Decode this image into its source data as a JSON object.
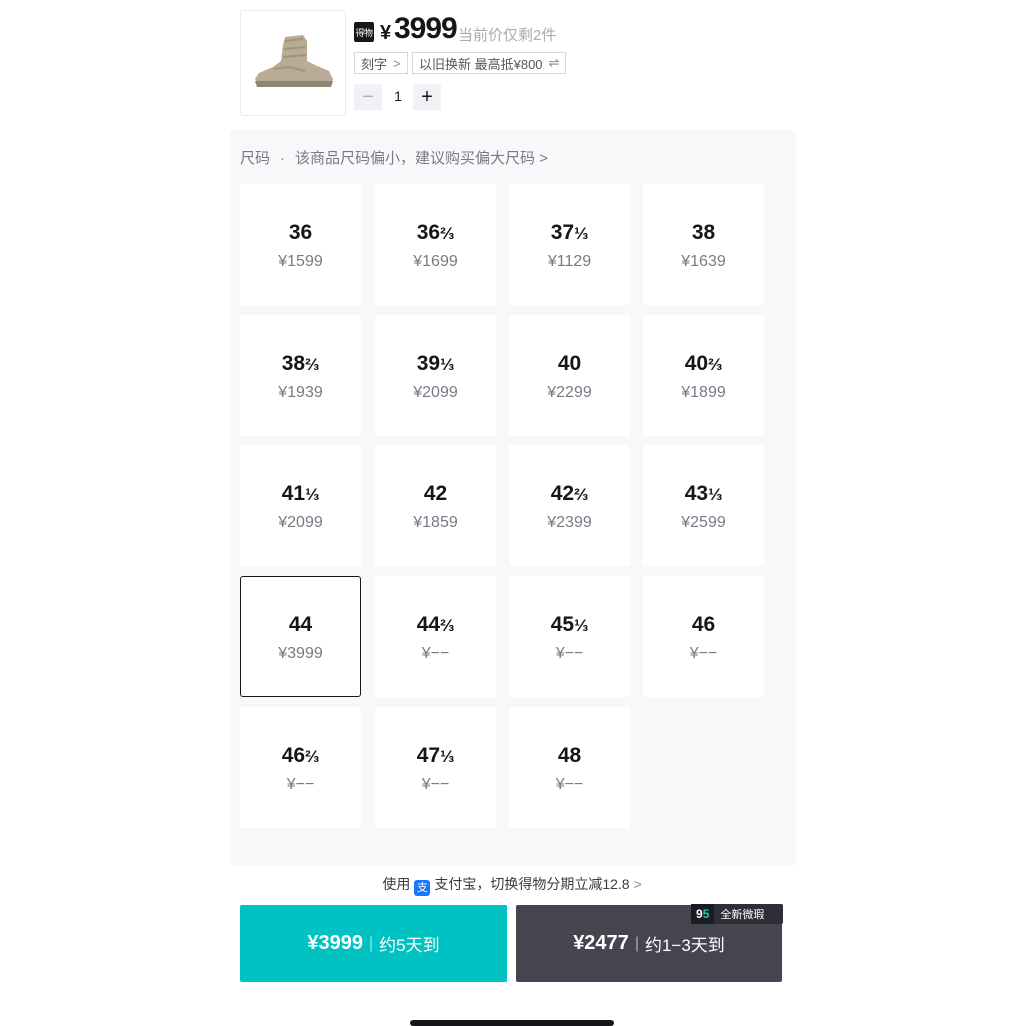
{
  "product": {
    "brand_badge": "得物",
    "currency": "¥",
    "price": "3999",
    "stock_note": "当前价仅剩2件",
    "engrave_chip": "刻字",
    "engrave_chip_symbol": ">",
    "trade_in_chip": "以旧换新 最高抵¥800",
    "trade_in_chip_symbol": "⇌",
    "quantity": "1",
    "minus_symbol": "−",
    "plus_symbol": "+"
  },
  "size_section": {
    "label": "尺码",
    "dot": "·",
    "hint": "该商品尺码偏小，建议购买偏大尺码",
    "chevron": ">",
    "selected": "44",
    "sizes": [
      {
        "whole": "36",
        "frac": "",
        "price": "¥1599"
      },
      {
        "whole": "36",
        "frac": "⅔",
        "price": "¥1699"
      },
      {
        "whole": "37",
        "frac": "⅓",
        "price": "¥1129"
      },
      {
        "whole": "38",
        "frac": "",
        "price": "¥1639"
      },
      {
        "whole": "38",
        "frac": "⅔",
        "price": "¥1939"
      },
      {
        "whole": "39",
        "frac": "⅓",
        "price": "¥2099"
      },
      {
        "whole": "40",
        "frac": "",
        "price": "¥2299"
      },
      {
        "whole": "40",
        "frac": "⅔",
        "price": "¥1899"
      },
      {
        "whole": "41",
        "frac": "⅓",
        "price": "¥2099"
      },
      {
        "whole": "42",
        "frac": "",
        "price": "¥1859"
      },
      {
        "whole": "42",
        "frac": "⅔",
        "price": "¥2399"
      },
      {
        "whole": "43",
        "frac": "⅓",
        "price": "¥2599"
      },
      {
        "whole": "44",
        "frac": "",
        "price": "¥3999"
      },
      {
        "whole": "44",
        "frac": "⅔",
        "price": "¥−−"
      },
      {
        "whole": "45",
        "frac": "⅓",
        "price": "¥−−"
      },
      {
        "whole": "46",
        "frac": "",
        "price": "¥−−"
      },
      {
        "whole": "46",
        "frac": "⅔",
        "price": "¥−−"
      },
      {
        "whole": "47",
        "frac": "⅓",
        "price": "¥−−"
      },
      {
        "whole": "48",
        "frac": "",
        "price": "¥−−"
      }
    ]
  },
  "promo": {
    "prefix": "使用",
    "alipay_icon_char": "支",
    "text": "支付宝，切换得物分期立减12.8",
    "chevron": ">"
  },
  "buy_buttons": {
    "primary": {
      "price": "¥3999",
      "separator": "|",
      "delivery": "约5天到",
      "color": "#00c2c2"
    },
    "secondary": {
      "price": "¥2477",
      "separator": "|",
      "delivery": "约1−3天到",
      "color": "#45454f",
      "tag_num_a": "9",
      "tag_num_b": "5",
      "tag_text": "全新微瑕"
    }
  }
}
